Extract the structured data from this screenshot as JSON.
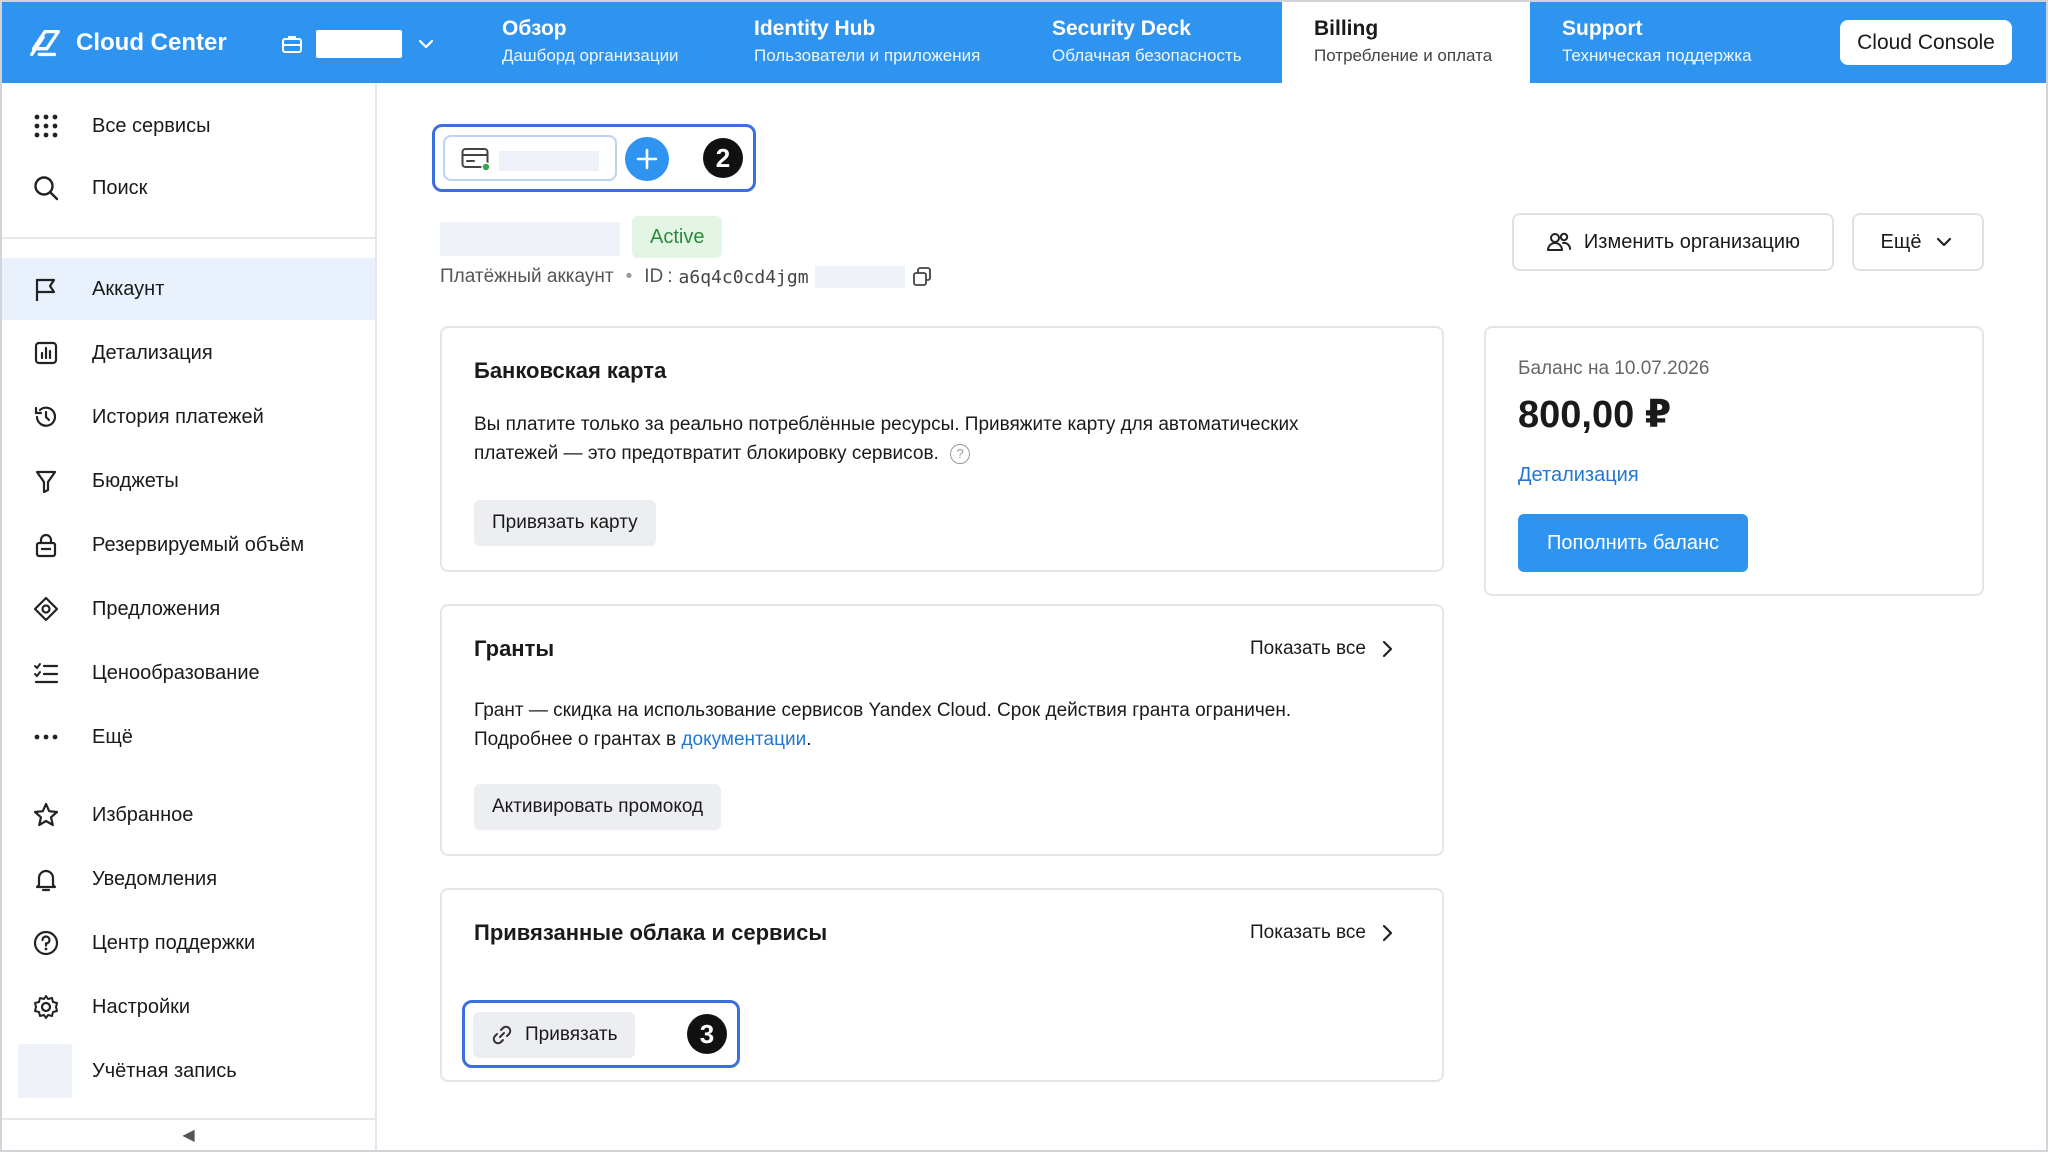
{
  "header": {
    "brand": "Cloud Center",
    "tabs": [
      {
        "title": "Обзор",
        "subtitle": "Дашборд организации"
      },
      {
        "title": "Identity Hub",
        "subtitle": "Пользователи и приложения"
      },
      {
        "title": "Security Deck",
        "subtitle": "Облачная безопасность"
      },
      {
        "title": "Billing",
        "subtitle": "Потребление и оплата"
      },
      {
        "title": "Support",
        "subtitle": "Техническая поддержка"
      }
    ],
    "console_button": "Cloud Console"
  },
  "sidebar": {
    "top": [
      {
        "label": "Все сервисы",
        "icon": "grid-icon"
      },
      {
        "label": "Поиск",
        "icon": "search-icon"
      }
    ],
    "items": [
      {
        "label": "Аккаунт",
        "icon": "flag-icon"
      },
      {
        "label": "Детализация",
        "icon": "chart-icon"
      },
      {
        "label": "История платежей",
        "icon": "history-icon"
      },
      {
        "label": "Бюджеты",
        "icon": "funnel-icon"
      },
      {
        "label": "Резервируемый объём",
        "icon": "lock-icon"
      },
      {
        "label": "Предложения",
        "icon": "offer-icon"
      },
      {
        "label": "Ценообразование",
        "icon": "list-check-icon"
      },
      {
        "label": "Ещё",
        "icon": "more-icon"
      }
    ],
    "bottom": [
      {
        "label": "Избранное",
        "icon": "star-icon"
      },
      {
        "label": "Уведомления",
        "icon": "bell-icon"
      },
      {
        "label": "Центр поддержки",
        "icon": "help-icon"
      },
      {
        "label": "Настройки",
        "icon": "gear-icon"
      },
      {
        "label": "Учётная запись",
        "icon": "avatar"
      }
    ],
    "collapse_glyph": "◀"
  },
  "account": {
    "annotation_2": "2",
    "status": "Active",
    "type_label": "Платёжный аккаунт",
    "id_label": "ID",
    "id_value": "a6q4c0cd4jgm",
    "change_org_button": "Изменить организацию",
    "more_button": "Ещё"
  },
  "bank_card": {
    "title": "Банковская карта",
    "text_line1": "Вы платите только за реально потреблённые ресурсы. Привяжите карту для автоматических",
    "text_line2": "платежей — это предотвратит блокировку сервисов.",
    "button": "Привязать карту"
  },
  "grants": {
    "title": "Гранты",
    "show_all": "Показать все",
    "text_line1": "Грант — скидка на использование сервисов Yandex Cloud. Срок действия гранта ограничен.",
    "text_line2_prefix": "Подробнее о грантах в ",
    "text_line2_link": "документации",
    "text_line2_suffix": ".",
    "button": "Активировать промокод"
  },
  "linked": {
    "title": "Привязанные облака и сервисы",
    "show_all": "Показать все",
    "button": "Привязать",
    "annotation_3": "3"
  },
  "balance": {
    "label": "Баланс на 10.07.2026",
    "amount": "800,00 ₽",
    "detail_link": "Детализация",
    "topup_button": "Пополнить баланс"
  },
  "colors": {
    "accent": "#2f93f0",
    "annotation_border": "#3b6fe0",
    "status_bg": "#e3f5e4",
    "status_text": "#2d8a3b",
    "link": "#1f78d1"
  }
}
